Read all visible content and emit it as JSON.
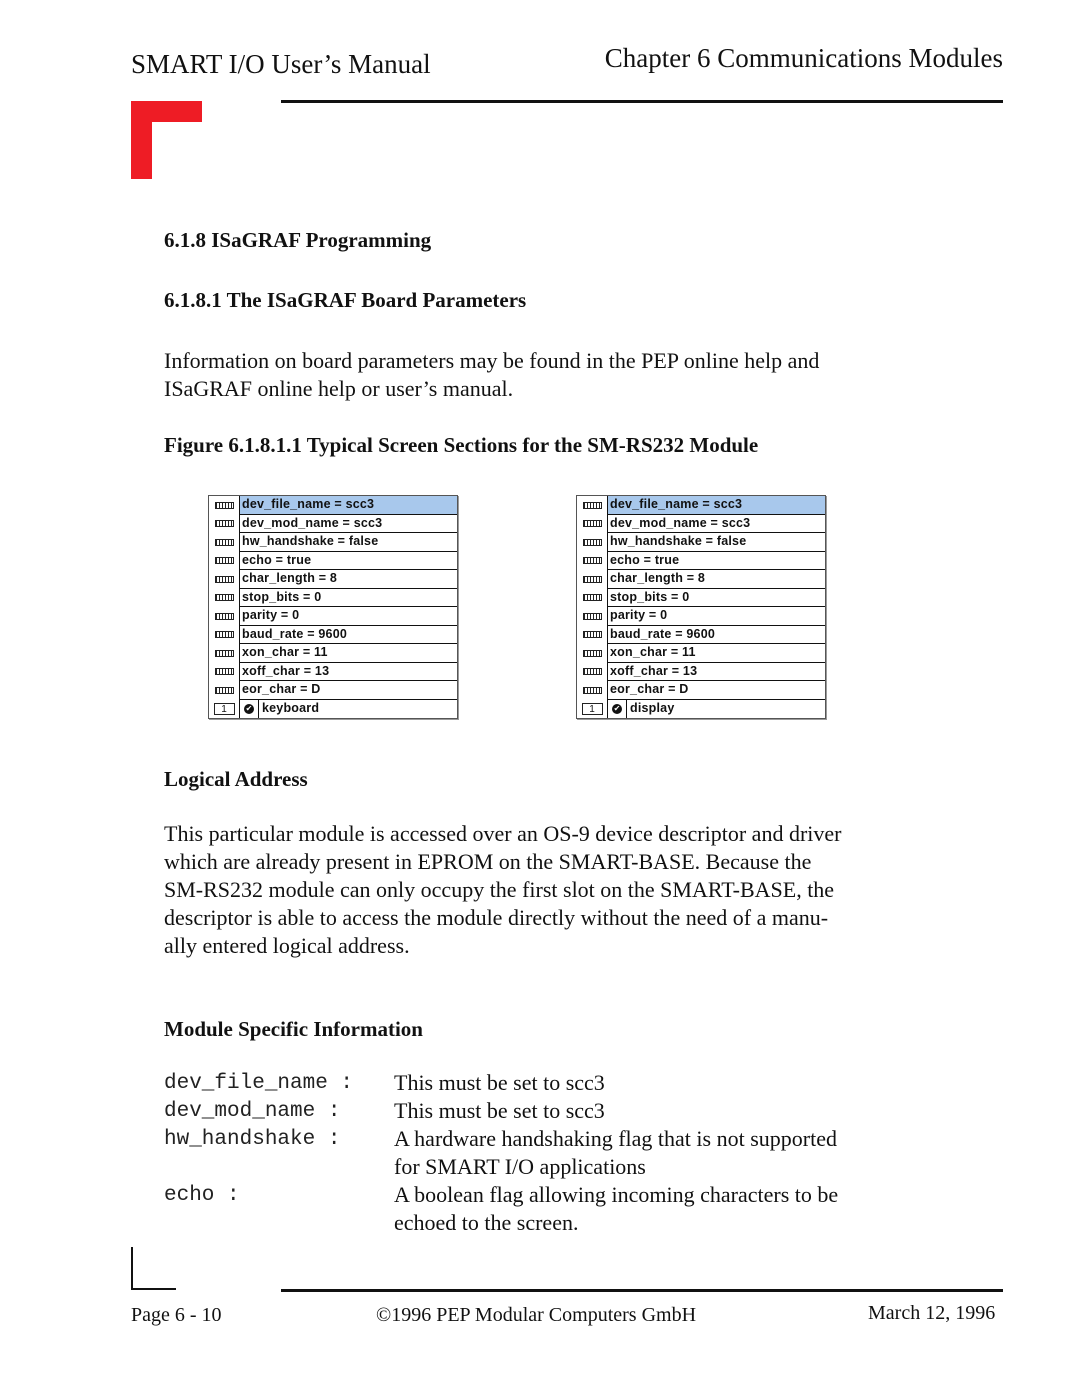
{
  "header": {
    "manual_title": "SMART I/O User’s Manual",
    "chapter_title": "Chapter 6  Communications Modules"
  },
  "sections": {
    "section_heading": "6.1.8 ISaGRAF Programming",
    "subsection_heading": "6.1.8.1 The ISaGRAF Board Parameters",
    "intro_lines": [
      "Information on board parameters may be found in the PEP online help and",
      "ISaGRAF online help or user’s manual."
    ],
    "figure_caption": "Figure 6.1.8.1.1 Typical Screen Sections for the SM-RS232 Module"
  },
  "panels": [
    {
      "params": [
        "dev_file_name = scc3",
        "dev_mod_name = scc3",
        "hw_handshake = false",
        "echo = true",
        "char_length = 8",
        "stop_bits = 0",
        "parity = 0",
        "baud_rate = 9600",
        "xon_char = 11",
        "xoff_char = 13",
        "eor_char = D"
      ],
      "selected_index": 0,
      "channel_number": "1",
      "channel_label": "keyboard"
    },
    {
      "params": [
        "dev_file_name = scc3",
        "dev_mod_name = scc3",
        "hw_handshake = false",
        "echo = true",
        "char_length = 8",
        "stop_bits = 0",
        "parity = 0",
        "baud_rate = 9600",
        "xon_char = 11",
        "xoff_char = 13",
        "eor_char = D"
      ],
      "selected_index": 0,
      "channel_number": "1",
      "channel_label": "display"
    }
  ],
  "logical_address": {
    "heading": "Logical Address",
    "lines": [
      "This particular module is accessed over an OS-9 device descriptor and driver",
      "which are already present in EPROM on the SMART-BASE. Because the",
      "SM-RS232 module can only occupy the first slot on the SMART-BASE, the",
      "descriptor is able to access the module directly without the need of a manu-",
      "ally entered logical address."
    ]
  },
  "module_info": {
    "heading": "Module Specific Information",
    "items": [
      {
        "name": "dev_file_name :",
        "desc": [
          "This must be set to scc3"
        ]
      },
      {
        "name": "dev_mod_name :",
        "desc": [
          "This must be set to scc3"
        ]
      },
      {
        "name": "hw_handshake :",
        "desc": [
          "A hardware handshaking flag that is not supported",
          "for SMART I/O applications"
        ]
      },
      {
        "name": "echo :",
        "desc": [
          "A boolean flag allowing incoming characters to be",
          "echoed to the screen."
        ]
      }
    ]
  },
  "footer": {
    "page": "Page 6 - 10",
    "copyright": "©1996 PEP Modular Computers GmbH",
    "date": "March 12, 1996"
  },
  "colors": {
    "brand_red": "#ee1c25",
    "selection_blue": "#a8c8ec"
  },
  "icons": {
    "param_icon": "memory-chip-icon",
    "channel_icon": "check-circle-icon"
  }
}
